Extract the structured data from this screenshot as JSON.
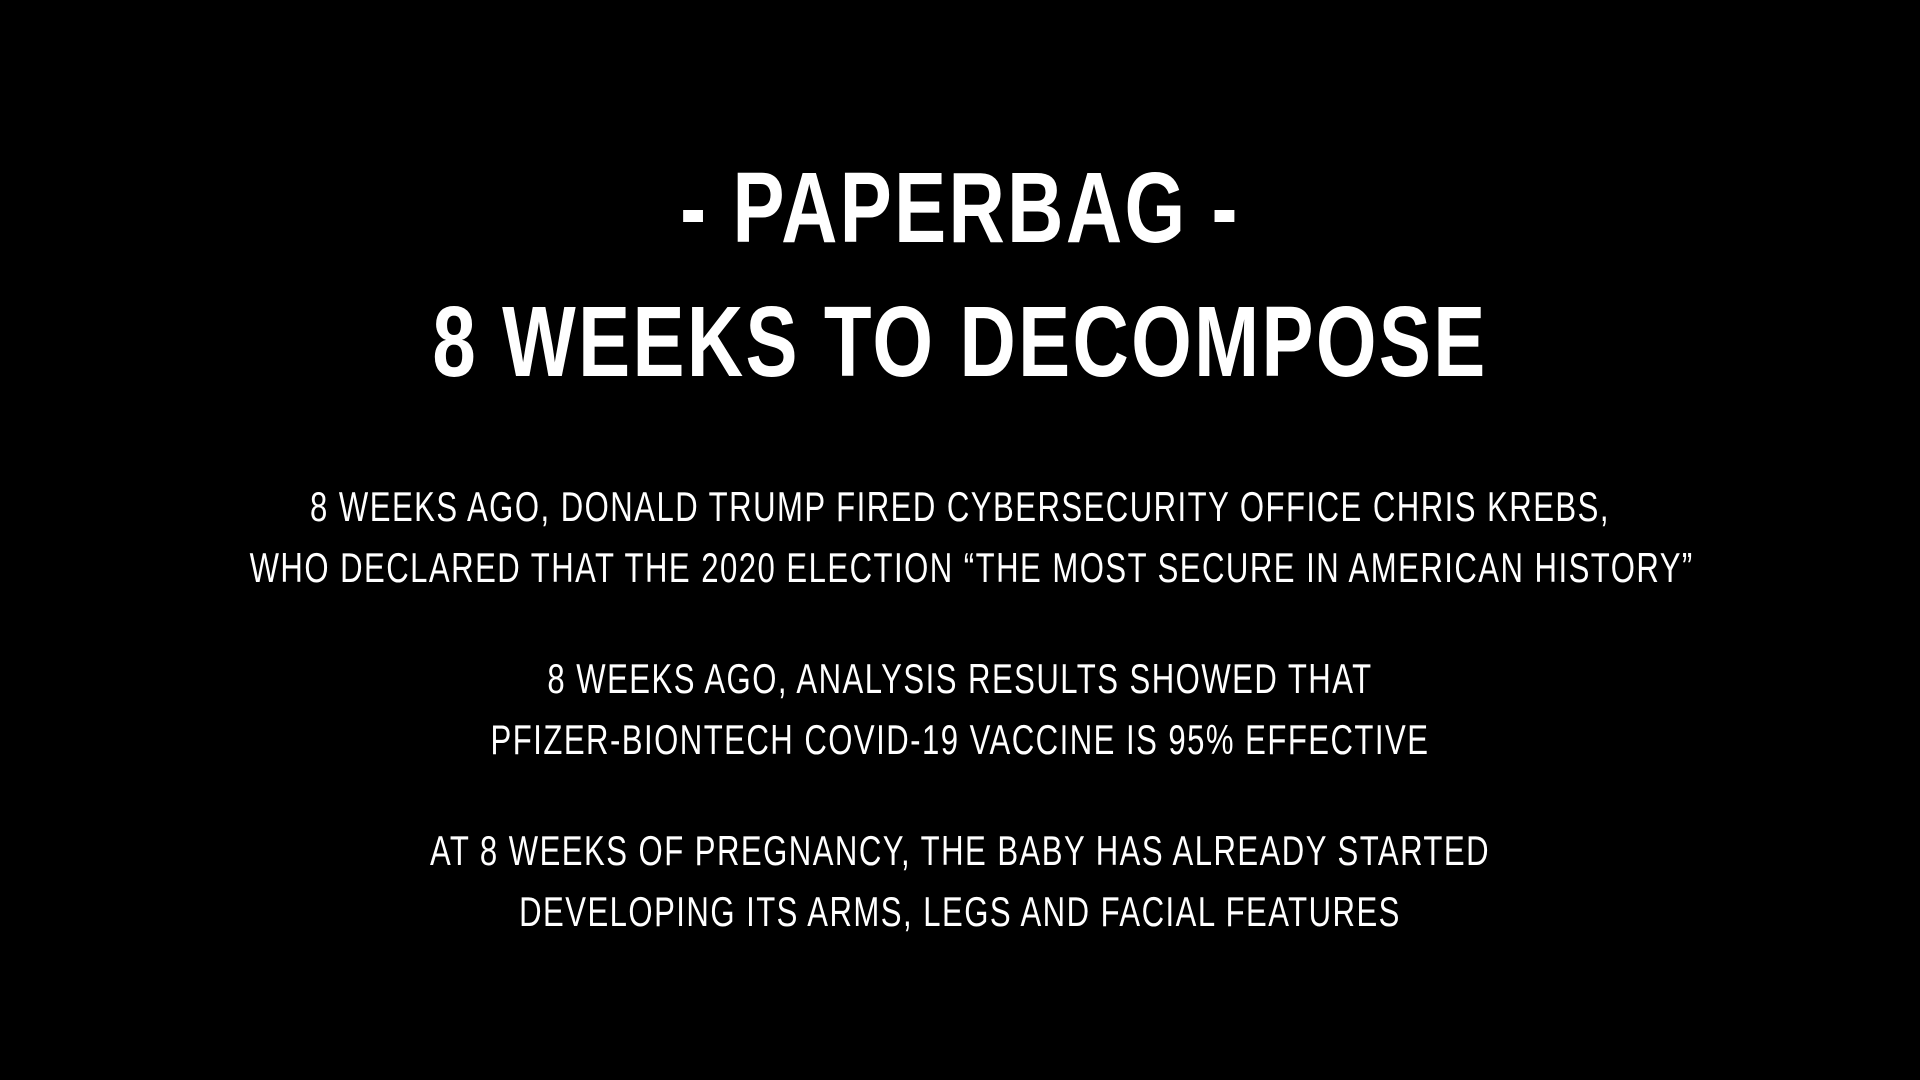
{
  "slide": {
    "background_color": "#000000",
    "text_color": "#ffffff",
    "title": "- PAPERBAG -",
    "subtitle": "8 WEEKS TO DECOMPOSE",
    "paragraphs": [
      {
        "line1": "8 WEEKS AGO, DONALD TRUMP FIRED CYBERSECURITY OFFICE CHRIS KREBS,",
        "line2": "WHO DECLARED THAT THE 2020 ELECTION “THE MOST SECURE IN AMERICAN HISTORY”"
      },
      {
        "line1": "8 WEEKS AGO, ANALYSIS RESULTS SHOWED THAT",
        "line2": "PFIZER-BIONTECH COVID-19 VACCINE IS 95% EFFECTIVE"
      },
      {
        "line1": "AT 8 WEEKS OF PREGNANCY, THE BABY HAS ALREADY STARTED",
        "line2": "DEVELOPING ITS ARMS, LEGS AND FACIAL FEATURES"
      }
    ]
  }
}
